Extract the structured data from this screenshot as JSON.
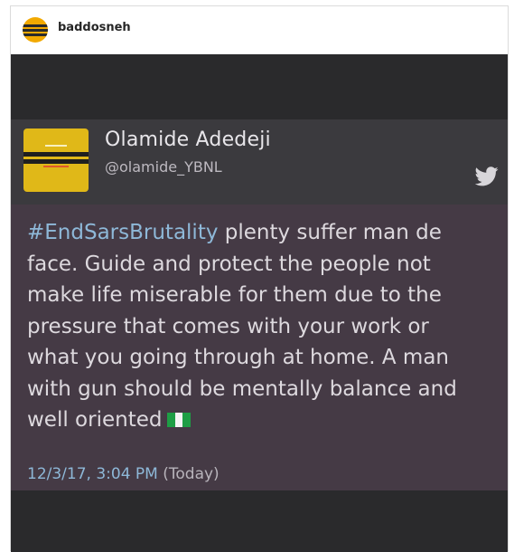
{
  "post": {
    "username": "baddosneh"
  },
  "tweet": {
    "name": "Olamide Adedeji",
    "handle": "@olamide_YBNL",
    "hashtag": "#EndSarsBrutality",
    "lines": [
      " plenty suffer man de",
      "face. Guide and protect the people not",
      "make life miserable for them due to the",
      "pressure that comes with your work or",
      "what you going through at home. A man",
      "with gun should be mentally balance and",
      "well oriented"
    ],
    "flag_icon": "nigeria-flag-emoji",
    "timestamp": "12/3/17, 3:04 PM",
    "relative_time": "(Today)"
  },
  "icons": {
    "avatar": "profile-avatar",
    "bird": "twitter-bird-icon"
  },
  "colors": {
    "hashtag": "#8eb8d8",
    "card_background": "#453a45",
    "image_background": "#2a2a2c",
    "avatar_yellow": "#e0b818"
  }
}
